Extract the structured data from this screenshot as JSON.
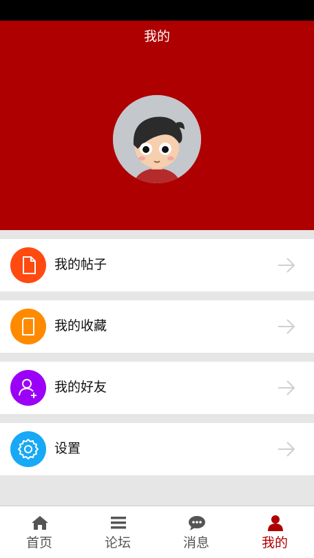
{
  "header": {
    "title": "我的"
  },
  "menu": {
    "items": [
      {
        "label": "我的帖子",
        "icon": "document-icon",
        "color": "#ff4a10"
      },
      {
        "label": "我的收藏",
        "icon": "bookmark-icon",
        "color": "#ff8a00"
      },
      {
        "label": "我的好友",
        "icon": "add-friend-icon",
        "color": "#9b00f7"
      },
      {
        "label": "设置",
        "icon": "gear-icon",
        "color": "#17a9f5"
      }
    ]
  },
  "tabbar": {
    "items": [
      {
        "label": "首页",
        "icon": "home-icon",
        "active": false
      },
      {
        "label": "论坛",
        "icon": "list-icon",
        "active": false
      },
      {
        "label": "消息",
        "icon": "chat-icon",
        "active": false
      },
      {
        "label": "我的",
        "icon": "user-icon",
        "active": true
      }
    ],
    "active_color": "#ae0000",
    "inactive_color": "#555555"
  },
  "colors": {
    "header_bg": "#ae0000",
    "page_bg": "#e6e6e6"
  }
}
